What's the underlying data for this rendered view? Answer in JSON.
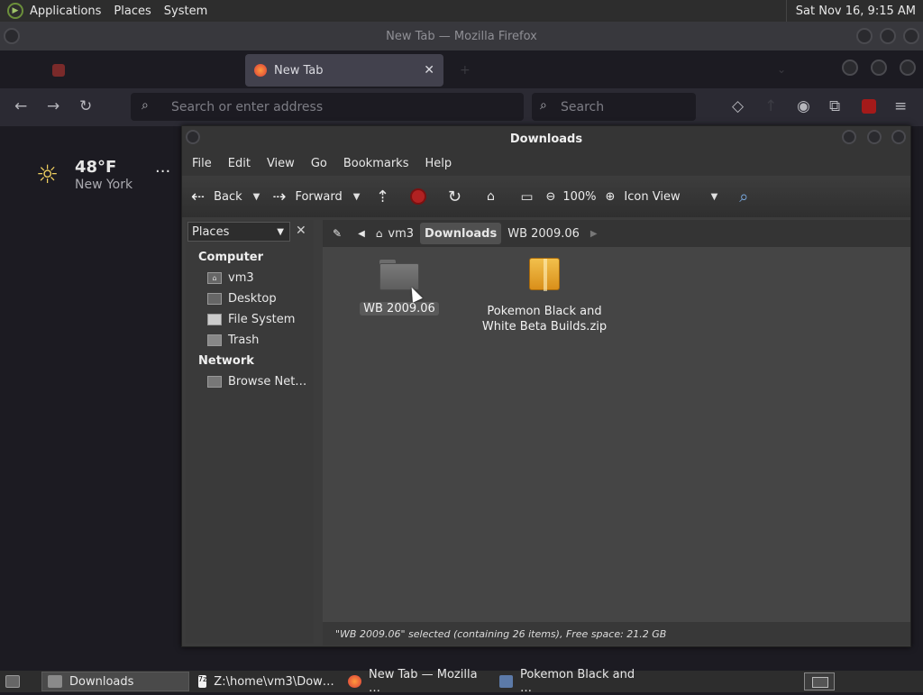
{
  "top_panel": {
    "menus": [
      "Applications",
      "Places",
      "System"
    ],
    "clock": "Sat Nov 16,  9:15 AM"
  },
  "firefox": {
    "window_title": "New Tab — Mozilla Firefox",
    "tabs": [
      {
        "label": "New Tab",
        "icon": "firefox-icon",
        "active": true
      }
    ],
    "urlbar_placeholder": "Search or enter address",
    "searchbar_placeholder": "Search",
    "weather": {
      "temp": "48°F",
      "city": "New York",
      "more": "···"
    }
  },
  "file_manager": {
    "title": "Downloads",
    "menu": [
      "File",
      "Edit",
      "View",
      "Go",
      "Bookmarks",
      "Help"
    ],
    "toolbar": {
      "back": "Back",
      "forward": "Forward",
      "zoom": "100%",
      "view_mode": "Icon View"
    },
    "side_pane": {
      "selector": "Places",
      "sections": [
        {
          "title": "Computer",
          "items": [
            "vm3",
            "Desktop",
            "File System",
            "Trash"
          ]
        },
        {
          "title": "Network",
          "items": [
            "Browse Net…"
          ]
        }
      ]
    },
    "path": [
      "vm3",
      "Downloads",
      "WB 2009.06"
    ],
    "active_path": "Downloads",
    "items": [
      {
        "name": "WB 2009.06",
        "type": "folder",
        "selected": true
      },
      {
        "name_line1": "Pokemon Black and",
        "name_line2": "White Beta Builds.zip",
        "type": "zip",
        "selected": false
      }
    ],
    "status": "\"WB 2009.06\" selected (containing 26 items), Free space: 21.2 GB"
  },
  "taskbar": [
    {
      "label": "Downloads",
      "icon": "folder-icon",
      "active": true
    },
    {
      "label": "Z:\\home\\vm3\\Dow…",
      "icon": "7zip-icon",
      "active": false
    },
    {
      "label": "New Tab — Mozilla …",
      "icon": "firefox-icon",
      "active": false
    },
    {
      "label": "Pokemon Black and …",
      "icon": "archive-manager-icon",
      "active": false
    }
  ],
  "colors": {
    "accent_selection": "#5a5a5a",
    "panel": "#2d2d2d",
    "firefox_bg": "#1c1b22"
  }
}
